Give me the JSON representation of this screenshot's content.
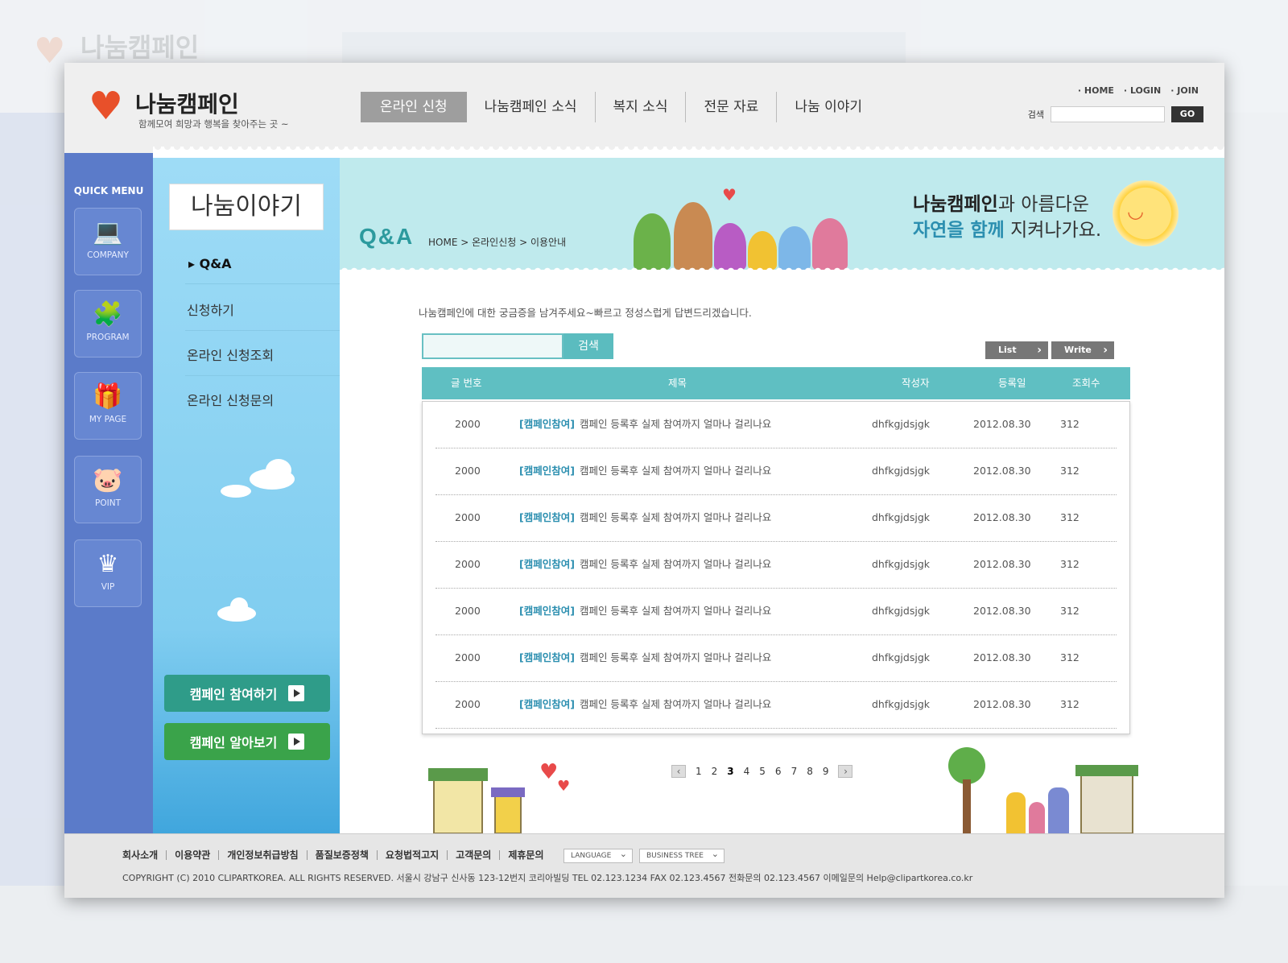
{
  "header": {
    "logo_title": "나눔캠페인",
    "logo_sub": "함께모여 희망과 행복을 찾아주는 곳 ~",
    "nav": [
      "온라인 신청",
      "나눔캠페인 소식",
      "복지 소식",
      "전문 자료",
      "나눔 이야기"
    ],
    "util_links": [
      "HOME",
      "LOGIN",
      "JOIN"
    ],
    "search_label": "검색",
    "go_label": "GO"
  },
  "quick_menu": {
    "title": "QUICK MENU",
    "items": [
      {
        "label": "COMPANY",
        "icon": "computer-icon"
      },
      {
        "label": "PROGRAM",
        "icon": "puzzle-icon"
      },
      {
        "label": "MY PAGE",
        "icon": "gift-icon"
      },
      {
        "label": "POINT",
        "icon": "piggy-bank-icon"
      },
      {
        "label": "VIP",
        "icon": "crown-icon"
      }
    ]
  },
  "sub_menu": {
    "title": "나눔이야기",
    "items": [
      "Q&A",
      "신청하기",
      "온라인 신청조회",
      "온라인 신청문의"
    ],
    "campaign_buttons": [
      "캠페인 참여하기",
      "캠페인 알아보기"
    ]
  },
  "banner": {
    "page_title": "Q&A",
    "breadcrumb": "HOME > 온라인신청 > 이용안내",
    "slogan_bold1": "나눔캠페인",
    "slogan_rest1": "과 아름다운",
    "slogan_bold2": "자연을 함께",
    "slogan_rest2": " 지켜나가요."
  },
  "board": {
    "intro": "나눔캠페인에 대한 궁금증을 남겨주세요~빠르고 정성스럽게 답변드리겠습니다.",
    "search_button": "검색",
    "list_button": "List",
    "write_button": "Write",
    "columns": [
      "글 번호",
      "제목",
      "작성자",
      "등록일",
      "조회수"
    ],
    "rows": [
      {
        "no": "2000",
        "tag": "[캠페인참여]",
        "title": "캠페인 등록후 실제 참여까지 얼마나 걸리나요",
        "author": "dhfkgjdsjgk",
        "date": "2012.08.30",
        "views": "312"
      },
      {
        "no": "2000",
        "tag": "[캠페인참여]",
        "title": "캠페인 등록후 실제 참여까지 얼마나 걸리나요",
        "author": "dhfkgjdsjgk",
        "date": "2012.08.30",
        "views": "312"
      },
      {
        "no": "2000",
        "tag": "[캠페인참여]",
        "title": "캠페인 등록후 실제 참여까지 얼마나 걸리나요",
        "author": "dhfkgjdsjgk",
        "date": "2012.08.30",
        "views": "312"
      },
      {
        "no": "2000",
        "tag": "[캠페인참여]",
        "title": "캠페인 등록후 실제 참여까지 얼마나 걸리나요",
        "author": "dhfkgjdsjgk",
        "date": "2012.08.30",
        "views": "312"
      },
      {
        "no": "2000",
        "tag": "[캠페인참여]",
        "title": "캠페인 등록후 실제 참여까지 얼마나 걸리나요",
        "author": "dhfkgjdsjgk",
        "date": "2012.08.30",
        "views": "312"
      },
      {
        "no": "2000",
        "tag": "[캠페인참여]",
        "title": "캠페인 등록후 실제 참여까지 얼마나 걸리나요",
        "author": "dhfkgjdsjgk",
        "date": "2012.08.30",
        "views": "312"
      },
      {
        "no": "2000",
        "tag": "[캠페인참여]",
        "title": "캠페인 등록후 실제 참여까지 얼마나 걸리나요",
        "author": "dhfkgjdsjgk",
        "date": "2012.08.30",
        "views": "312"
      }
    ],
    "pages": [
      "1",
      "2",
      "3",
      "4",
      "5",
      "6",
      "7",
      "8",
      "9"
    ],
    "current_page": "3"
  },
  "footer": {
    "links": [
      "회사소개",
      "이용약관",
      "개인정보취급방침",
      "품질보증정책",
      "요청법적고지",
      "고객문의",
      "제휴문의"
    ],
    "language_select": "LANGUAGE",
    "business_select": "BUSINESS TREE",
    "copyright": "COPYRIGHT (C) 2010 CLIPARTKOREA. ALL RIGHTS RESERVED.   서울시 강남구 신사동 123-12번지 코리아빌딩  TEL 02.123.1234   FAX 02.123.4567   전화문의 02.123.4567   이메일문의  Help@clipartkorea.co.kr"
  },
  "colors": {
    "quick_menu_bg": "#5b7bc9",
    "teal_accent": "#5fbfc2",
    "banner_bg": "#bfeaed",
    "campaign_button_green": "#3aa34a"
  }
}
